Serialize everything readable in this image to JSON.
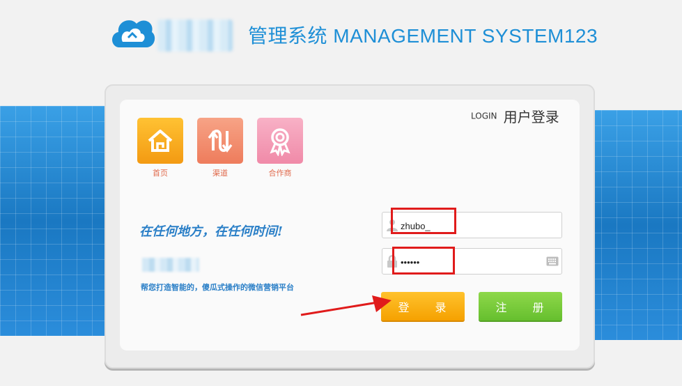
{
  "header": {
    "title": "管理系统 MANAGEMENT SYSTEM123"
  },
  "nav_tiles": [
    {
      "label": "首页",
      "icon": "home-icon",
      "color": "#f8a91f"
    },
    {
      "label": "渠道",
      "icon": "channel-arrows-icon",
      "color": "#f28a6c"
    },
    {
      "label": "合作商",
      "icon": "badge-ribbon-icon",
      "color": "#f49ab5"
    }
  ],
  "login": {
    "en_label": "LOGIN",
    "cn_label": "用户登录",
    "username_value": "zhubo_",
    "password_value": "••••••",
    "login_button": "登 录",
    "register_button": "注 册"
  },
  "promo": {
    "slogan": "在任何地方，在任何时间!",
    "tagline": "帮您打造智能的，傻瓜式操作的微信营销平台"
  },
  "colors": {
    "accent_blue": "#1e8fd6",
    "login_button": "#f5a100",
    "register_button": "#66bf2e",
    "annotation_red": "#e01b1b"
  }
}
